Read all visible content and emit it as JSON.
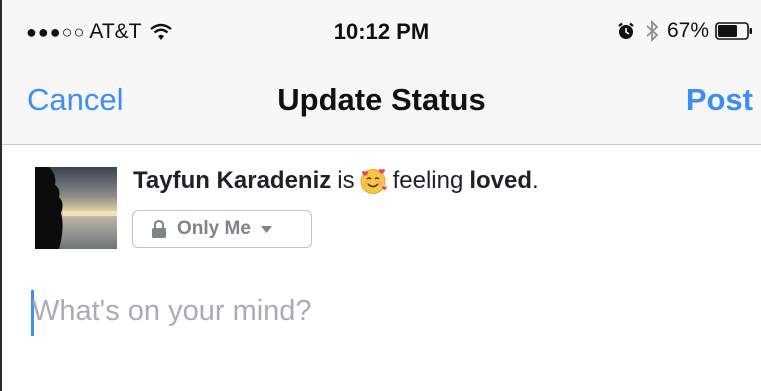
{
  "status_bar": {
    "signal": "●●●○○",
    "carrier": "AT&T",
    "time": "10:12 PM",
    "battery_percent": "67%",
    "icons": [
      "wifi-icon",
      "alarm-icon",
      "bluetooth-icon",
      "battery-icon"
    ]
  },
  "nav": {
    "cancel_label": "Cancel",
    "title": "Update Status",
    "post_label": "Post"
  },
  "post": {
    "author": "Tayfun Karadeniz",
    "is_text": "is",
    "feeling_text": "feeling",
    "feeling": "loved",
    "period": ".",
    "feeling_icon": "smiling-face-with-hearts-emoji",
    "privacy_label": "Only Me",
    "placeholder": "What's on your mind?"
  },
  "colors": {
    "accent": "#3d8ff5",
    "bar_background": "#f7f7f7",
    "placeholder_text": "#a9adb3",
    "privacy_text": "#7f848c"
  }
}
